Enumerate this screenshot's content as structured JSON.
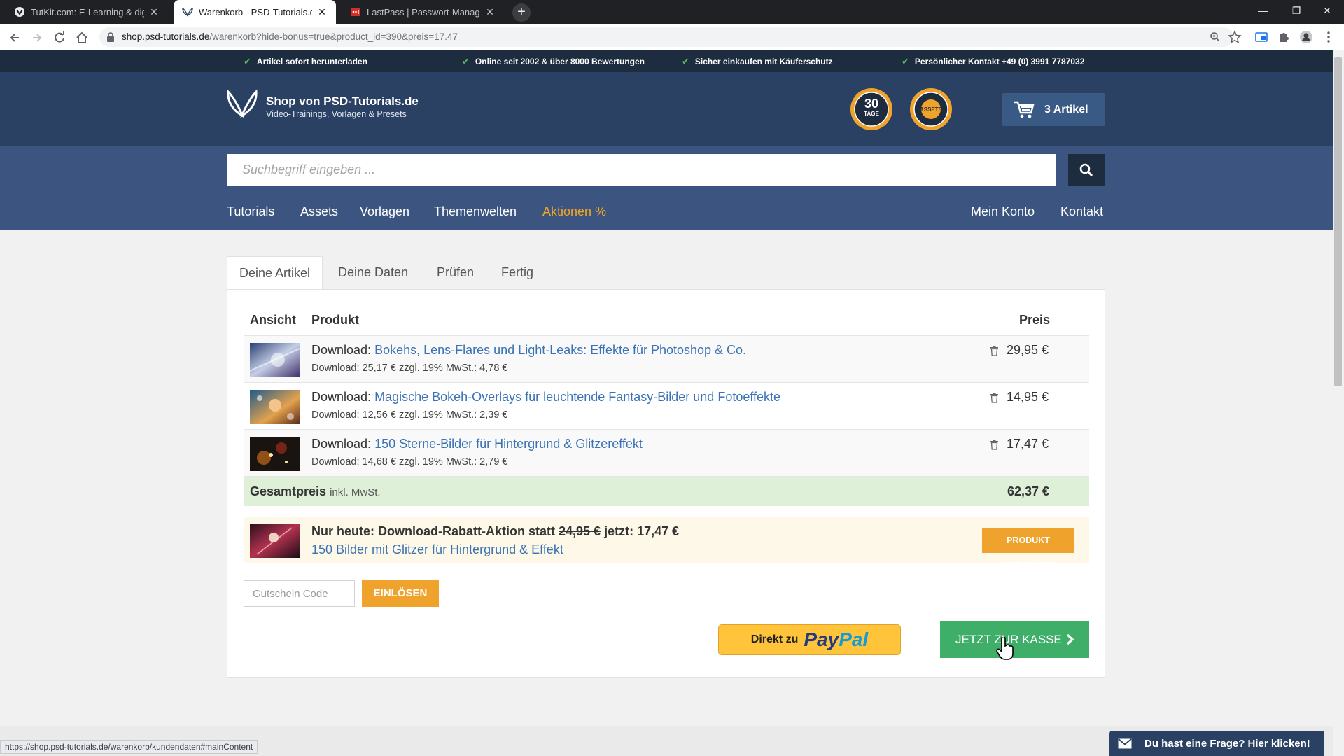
{
  "browser": {
    "tabs": [
      {
        "label": "TutKit.com: E-Learning & digitale",
        "active": false
      },
      {
        "label": "Warenkorb - PSD-Tutorials.de Sh",
        "active": true
      },
      {
        "label": "LastPass | Passwort-Manager, au",
        "active": false
      }
    ],
    "new_tab": "+",
    "url_host": "shop.psd-tutorials.de",
    "url_path": "/warenkorb?hide-bonus=true&product_id=390&preis=17.47",
    "status_url": "https://shop.psd-tutorials.de/warenkorb/kundendaten#mainContent"
  },
  "topbar": {
    "items": [
      "Artikel sofort herunterladen",
      "Online seit 2002 & über 8000 Bewertungen",
      "Sicher einkaufen mit Käuferschutz",
      "Persönlicher Kontakt +49 (0) 3991 7787032"
    ]
  },
  "header": {
    "shop_title": "Shop von PSD-Tutorials.de",
    "shop_subtitle": "Video-Trainings, Vorlagen & Presets",
    "badge1_num": "30",
    "badge1_text": "TAGE",
    "badge2_text": "ASSETS",
    "cart_label": "3 Artikel"
  },
  "search": {
    "placeholder": "Suchbegriff eingeben ..."
  },
  "nav": {
    "items": [
      "Tutorials",
      "Assets",
      "Vorlagen",
      "Themenwelten",
      "Aktionen %"
    ],
    "right": [
      "Mein Konto",
      "Kontakt"
    ]
  },
  "steps": [
    "Deine Artikel",
    "Deine Daten",
    "Prüfen",
    "Fertig"
  ],
  "cart": {
    "headers": {
      "view": "Ansicht",
      "product": "Produkt",
      "price": "Preis"
    },
    "items": [
      {
        "prefix": "Download:",
        "title": "Bokehs, Lens-Flares und Light-Leaks: Effekte für Photoshop & Co.",
        "detail": "Download: 25,17 € zzgl. 19% MwSt.: 4,78 €",
        "price": "29,95 €"
      },
      {
        "prefix": "Download:",
        "title": "Magische Bokeh-Overlays für leuchtende Fantasy-Bilder und Fotoeffekte",
        "detail": "Download: 12,56 € zzgl. 19% MwSt.: 2,39 €",
        "price": "14,95 €"
      },
      {
        "prefix": "Download:",
        "title": "150 Sterne-Bilder für Hintergrund & Glitzereffekt",
        "detail": "Download: 14,68 € zzgl. 19% MwSt.: 2,79 €",
        "price": "17,47 €"
      }
    ],
    "total_label": "Gesamtpreis",
    "total_note": "inkl. MwSt.",
    "total_value": "62,37 €"
  },
  "promo": {
    "text_a": "Nur heute: Download-Rabatt-Aktion statt",
    "old_price": "24,95 €",
    "text_b": "jetzt: 17,47 €",
    "product": "150 Bilder mit Glitzer für Hintergrund & Effekt",
    "button": "PRODUKT HINZUFÜGEN"
  },
  "coupon": {
    "placeholder": "Gutschein Code",
    "button": "EINLÖSEN"
  },
  "paypal": {
    "prefix": "Direkt zu",
    "brand_a": "Pay",
    "brand_b": "Pal"
  },
  "checkout": {
    "label": "JETZT ZUR KASSE"
  },
  "chat": {
    "label": "Du hast eine Frage? Hier klicken!"
  },
  "colors": {
    "header": "#2a4163",
    "strip": "#1d2c3f",
    "accent_orange": "#f0a32c",
    "checkout_green": "#3fae68",
    "link": "#3a72b5"
  }
}
